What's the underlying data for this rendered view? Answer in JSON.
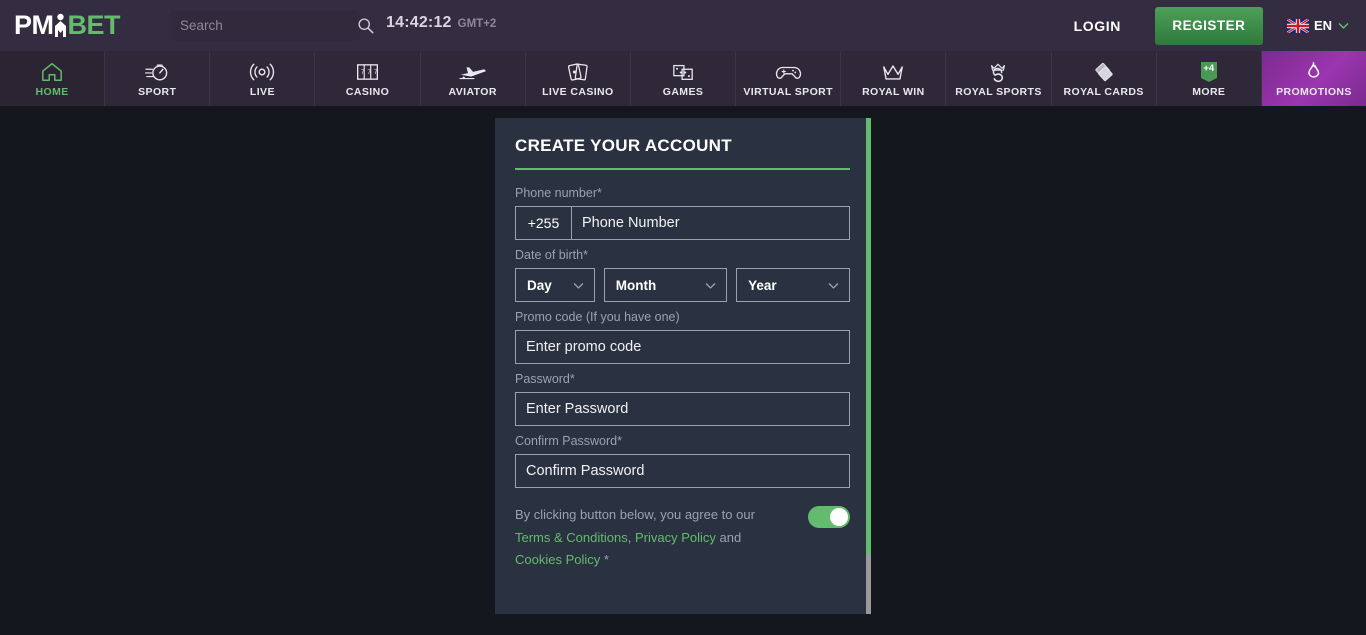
{
  "header": {
    "logo": {
      "part1": "PM",
      "part2": "BET",
      "icon": "person-figure-icon"
    },
    "search": {
      "placeholder": "Search",
      "value": "",
      "icon": "search-icon"
    },
    "clock": {
      "time": "14:42:12",
      "timezone": "GMT+2"
    },
    "login_label": "LOGIN",
    "register_label": "REGISTER",
    "language": {
      "code": "EN",
      "flag": "uk-flag-icon",
      "chevron": "chevron-down-icon"
    },
    "colors": {
      "bar_bg": "#342c41",
      "register_green": "#4c9f58",
      "accent_green": "#63bb6d"
    }
  },
  "nav": {
    "items": [
      {
        "label": "HOME",
        "icon": "home-icon",
        "active": true
      },
      {
        "label": "SPORT",
        "icon": "stopwatch-icon",
        "active": false
      },
      {
        "label": "LIVE",
        "icon": "broadcast-icon",
        "active": false
      },
      {
        "label": "CASINO",
        "icon": "slot-machine-icon",
        "active": false
      },
      {
        "label": "AVIATOR",
        "icon": "airplane-icon",
        "active": false
      },
      {
        "label": "LIVE CASINO",
        "icon": "playing-cards-icon",
        "active": false
      },
      {
        "label": "GAMES",
        "icon": "dice-icon",
        "active": false
      },
      {
        "label": "VIRTUAL SPORT",
        "icon": "gamepad-icon",
        "active": false
      },
      {
        "label": "ROYAL WIN",
        "icon": "crown-icon",
        "active": false
      },
      {
        "label": "ROYAL SPORTS",
        "icon": "crowned-s-icon",
        "active": false
      },
      {
        "label": "ROYAL CARDS",
        "icon": "stacked-cards-icon",
        "active": false
      },
      {
        "label": "MORE",
        "icon": "pennant-badge-icon",
        "badge": "+4",
        "active": false
      },
      {
        "label": "PROMOTIONS",
        "icon": "flame-icon",
        "active": false,
        "highlight": true
      }
    ]
  },
  "modal": {
    "title": "CREATE YOUR ACCOUNT",
    "phone": {
      "label": "Phone number*",
      "country_code": "+255",
      "placeholder": "Phone Number",
      "value": ""
    },
    "dob": {
      "label": "Date of birth*",
      "day": {
        "value": "Day",
        "chevron": "chevron-down-icon"
      },
      "month": {
        "value": "Month",
        "chevron": "chevron-down-icon"
      },
      "year": {
        "value": "Year",
        "chevron": "chevron-down-icon"
      }
    },
    "promo": {
      "label": "Promo code (If you have one)",
      "placeholder": "Enter promo code",
      "value": ""
    },
    "password": {
      "label": "Password*",
      "placeholder": "Enter Password",
      "value": ""
    },
    "confirm_password": {
      "label": "Confirm Password*",
      "placeholder": "Confirm Password",
      "value": ""
    },
    "terms": {
      "line1": "By clicking button below, you agree to our",
      "link_terms": "Terms & Conditions",
      "separator1": ",",
      "link_privacy": "Privacy Policy",
      "and": "and",
      "link_cookies": "Cookies Policy",
      "asterisk": "*",
      "toggle_on": true
    }
  }
}
